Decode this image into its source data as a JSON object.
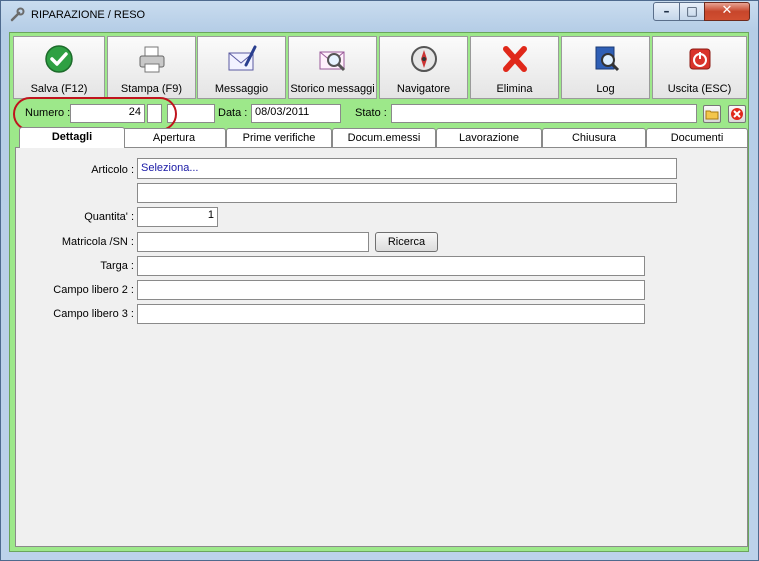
{
  "window": {
    "title": "RIPARAZIONE / RESO",
    "controls": {
      "minimize": "–",
      "maximize": "□",
      "close": "✕"
    }
  },
  "toolbar": [
    {
      "label": "Salva (F12)",
      "icon": "check-icon"
    },
    {
      "label": "Stampa (F9)",
      "icon": "printer-icon"
    },
    {
      "label": "Messaggio",
      "icon": "envelope-pen-icon"
    },
    {
      "label": "Storico messaggi",
      "icon": "envelope-search-icon"
    },
    {
      "label": "Navigatore",
      "icon": "compass-icon"
    },
    {
      "label": "Elimina",
      "icon": "delete-x-icon"
    },
    {
      "label": "Log",
      "icon": "book-search-icon"
    },
    {
      "label": "Uscita (ESC)",
      "icon": "power-icon"
    }
  ],
  "header": {
    "numero_label": "Numero :",
    "numero_value": "24",
    "data_label": "Data :",
    "data_value": "08/03/2011",
    "stato_label": "Stato :",
    "stato_value": ""
  },
  "tabs": [
    "Dettagli",
    "Apertura",
    "Prime verifiche",
    "Docum.emessi",
    "Lavorazione",
    "Chiusura",
    "Documenti"
  ],
  "active_tab": "Dettagli",
  "details": {
    "articolo_label": "Articolo :",
    "articolo_value": "Seleziona...",
    "articolo_desc": "",
    "quantita_label": "Quantita' :",
    "quantita_value": "1",
    "matricola_label": "Matricola /SN :",
    "matricola_value": "",
    "ricerca_label": "Ricerca",
    "targa_label": "Targa :",
    "targa_value": "",
    "campo2_label": "Campo libero 2 :",
    "campo2_value": "",
    "campo3_label": "Campo libero 3 :",
    "campo3_value": ""
  },
  "colors": {
    "frame_green": "#9de88a",
    "highlight_red": "#c0141d",
    "link_blue": "#1a1aa6"
  }
}
